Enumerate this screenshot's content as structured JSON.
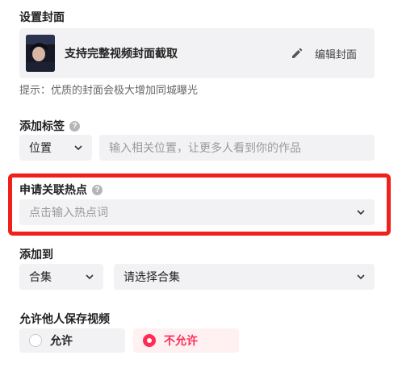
{
  "cover": {
    "title": "设置封面",
    "text": "支持完整视频封面截取",
    "edit_label": "编辑封面",
    "tip": "提示：优质的封面会极大增加同城曝光"
  },
  "tags": {
    "title": "添加标签",
    "type_value": "位置",
    "input_placeholder": "输入相关位置，让更多人看到你的作品"
  },
  "hotspot": {
    "title": "申请关联热点",
    "placeholder": "点击输入热点词"
  },
  "addto": {
    "title": "添加到",
    "type_value": "合集",
    "collection_value": "请选择合集"
  },
  "save": {
    "title": "允许他人保存视频",
    "option_allow": "允许",
    "option_deny": "不允许",
    "selected": "不允许"
  },
  "colors": {
    "highlight_border": "#f0201a",
    "accent_pink": "#fe2c55",
    "selected_bg": "#fff0f2",
    "field_bg": "#f2f2f4"
  },
  "icons": {
    "help": "help-circle-icon",
    "edit": "pencil-icon",
    "chevron": "chevron-down-icon"
  }
}
